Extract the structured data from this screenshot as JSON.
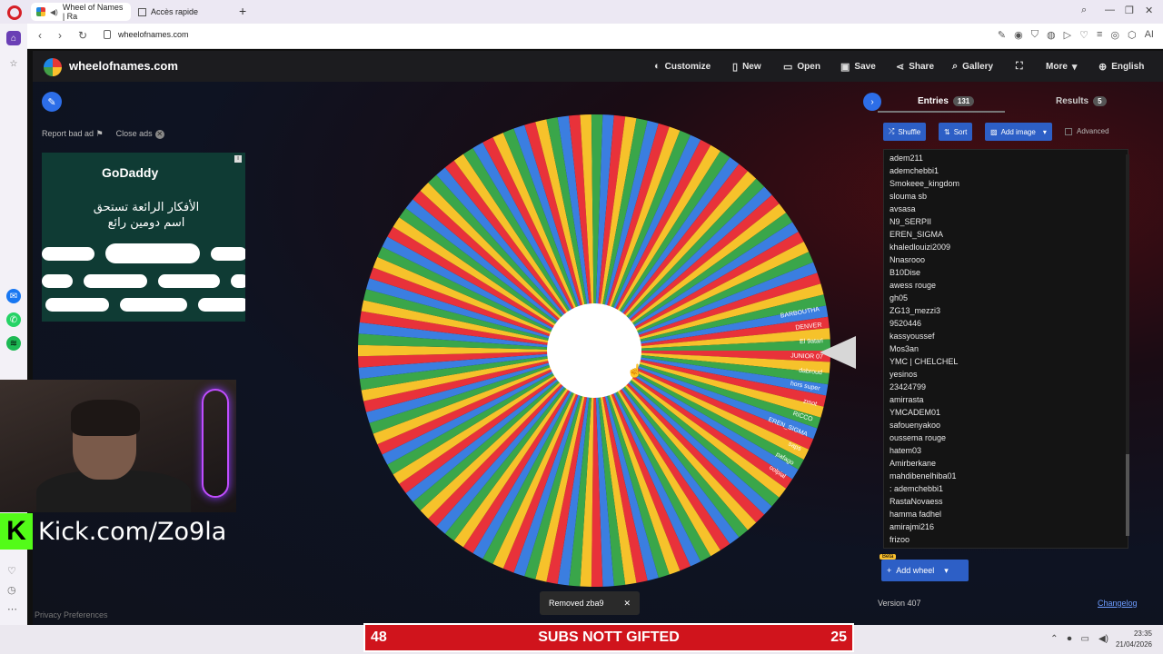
{
  "browser": {
    "tabs": [
      {
        "label": "Wheel of Names | Ra"
      },
      {
        "label": "Accès rapide"
      }
    ],
    "url": "wheelofnames.com",
    "ai_label": "AI"
  },
  "site": {
    "brand": "wheelofnames.com",
    "menu": [
      "Customize",
      "New",
      "Open",
      "Save",
      "Share",
      "Gallery",
      "More",
      "English"
    ],
    "ad_links": {
      "report": "Report bad ad",
      "close": "Close ads"
    },
    "ad": {
      "brand": "GoDaddy",
      "text_line1": "الأفكار الرائعة تستحق",
      "text_line2": "اسم دومين رائع"
    },
    "privacy": "Privacy Preferences",
    "toast": "Removed zba9",
    "panel": {
      "entries_tab": "Entries",
      "entries_count": "131",
      "results_tab": "Results",
      "results_count": "5",
      "shuffle": "Shuffle",
      "sort": "Sort",
      "add_image": "Add image",
      "advanced": "Advanced",
      "add_wheel": "Add wheel",
      "beta": "Beta",
      "version": "Version 407",
      "changelog": "Changelog"
    },
    "entries": [
      "adem211",
      "ademchebbi1",
      "Smokeee_kingdom",
      "slouma sb",
      "avsasa",
      "N9_SERPII",
      "EREN_SIGMA",
      "khaledlouizi2009",
      "Nnasrooo",
      "B10Dise",
      "awess rouge",
      "gh05",
      "ZG13_mezzi3",
      "9520446",
      "kassyoussef",
      "Mos3an",
      "YMC | CHELCHEL",
      "yesinos",
      "23424799",
      "amirrasta",
      "YMCADEM01",
      "safouenyakoo",
      "oussema rouge",
      "hatem03",
      "Amirberkane",
      "mahdibenelhiba01",
      ": ademchebbi1",
      "RastaNovaess",
      "hamma fadhel",
      "amirajmi216",
      "frizoo"
    ],
    "wheel": {
      "segments": 131,
      "colors": [
        "#e8323a",
        "#f6c22b",
        "#3aa64a",
        "#3b7ee0"
      ],
      "visible_labels": [
        "BARBOUTHA",
        "DENVER",
        "El 9atari",
        "JUNIOR 07",
        "dabroud",
        "hors super",
        "zmot",
        "RICCO",
        "EREN_SIGMA",
        "saps",
        "pafago",
        "oolpial"
      ]
    }
  },
  "stream": {
    "kick": "Kick.com/Zo9la",
    "subs_left": "48",
    "subs_text": "SUBS NOTT GIFTED",
    "subs_right": "25"
  },
  "taskbar": {
    "time": "23:35",
    "date": "21/04/2026"
  }
}
